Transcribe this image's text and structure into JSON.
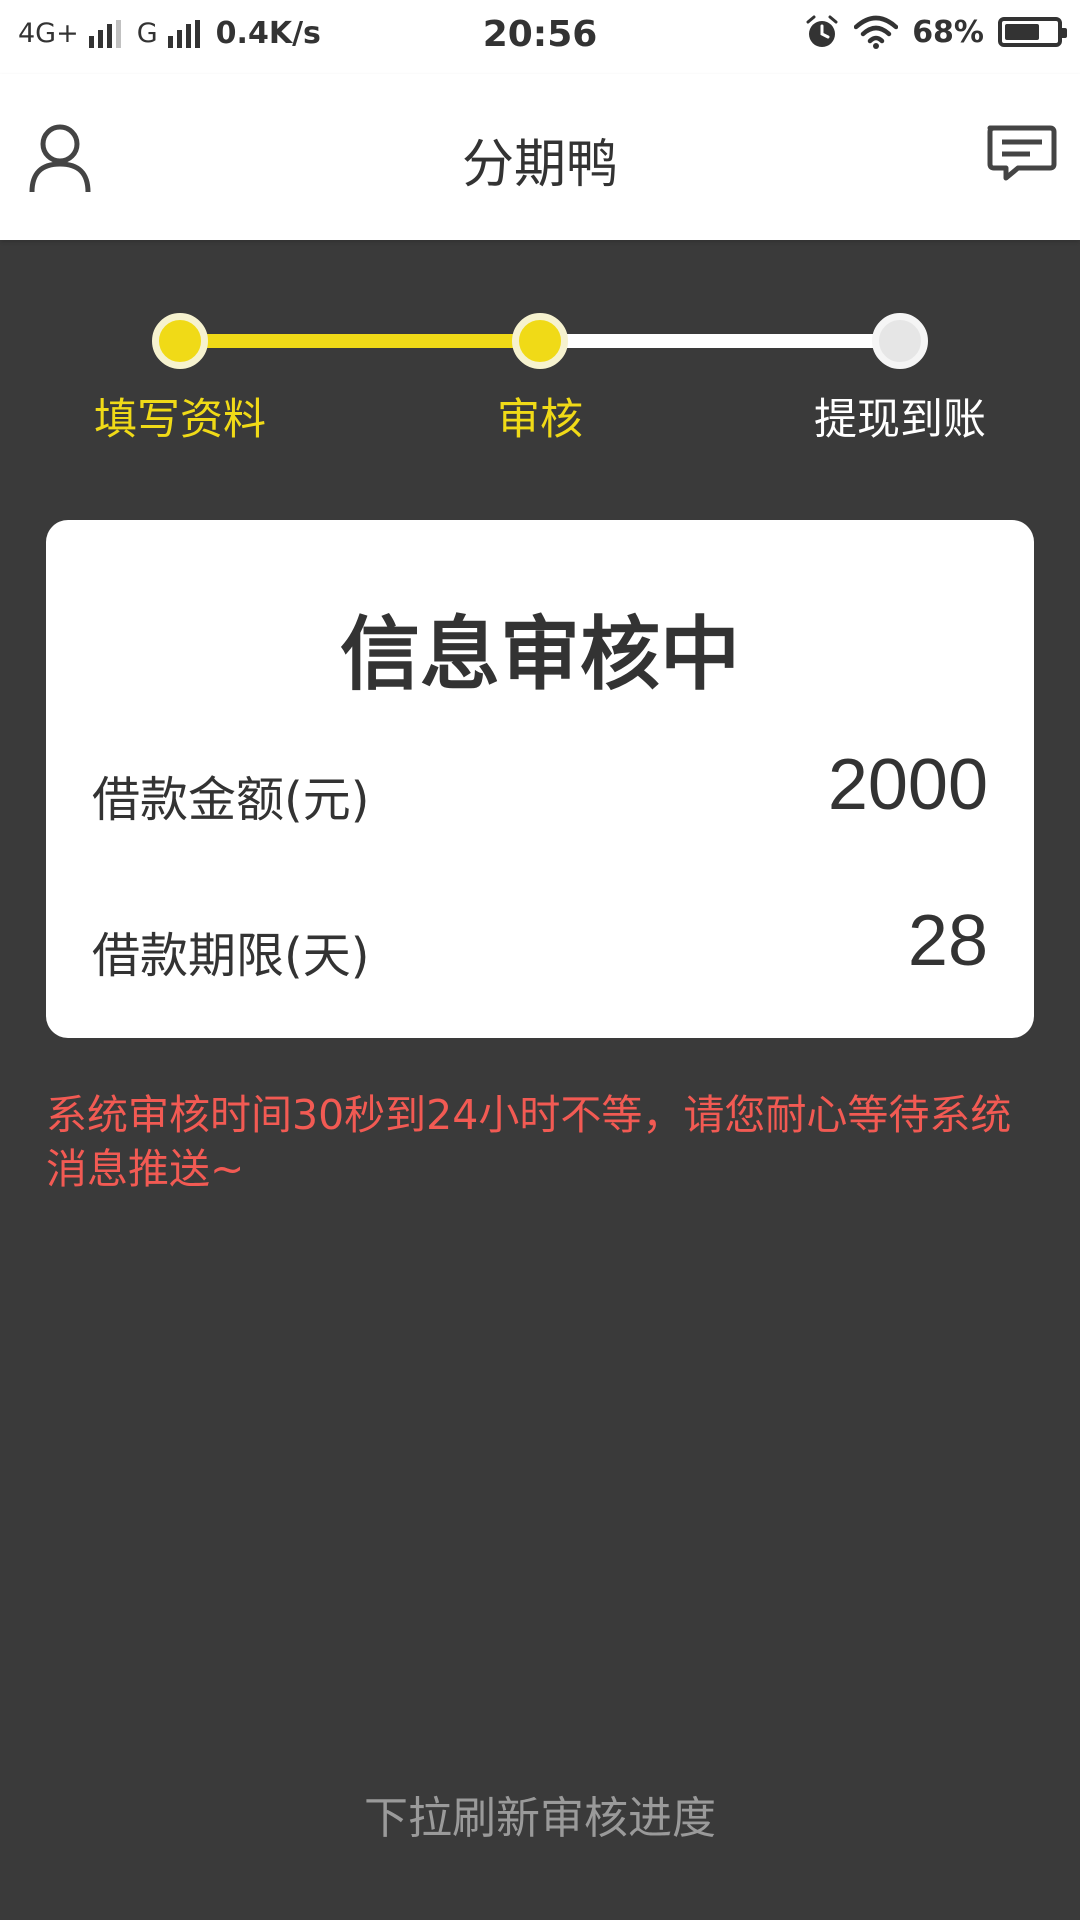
{
  "status_bar": {
    "network1": "4G+",
    "network2": "G",
    "speed": "0.4K/s",
    "time": "20:56",
    "battery": "68%",
    "battery_level": 0.68
  },
  "app_bar": {
    "title": "分期鸭",
    "left_icon": "user-icon",
    "right_icon": "message-icon"
  },
  "steps": [
    {
      "label": "填写资料",
      "state": "done"
    },
    {
      "label": "审核",
      "state": "current"
    },
    {
      "label": "提现到账",
      "state": "pending"
    }
  ],
  "colors": {
    "accent": "#f0da17",
    "background": "#3a3a3a",
    "notice": "#f25a53",
    "inactive": "#e6e6e6"
  },
  "card": {
    "title": "信息审核中",
    "rows": [
      {
        "label": "借款金额(元)",
        "value": "2000"
      },
      {
        "label": "借款期限(天)",
        "value": "28"
      }
    ]
  },
  "notice": "系统审核时间30秒到24小时不等，请您耐心等待系统消息推送~",
  "pull_hint": "下拉刷新审核进度"
}
